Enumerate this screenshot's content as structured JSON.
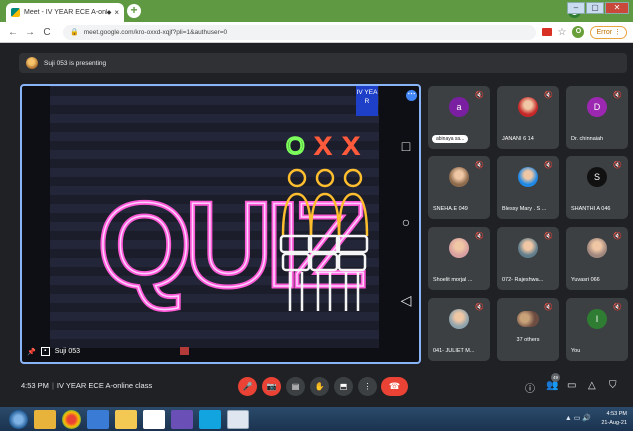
{
  "browser": {
    "tab_title": "Meet - IV YEAR ECE A-onlin",
    "tab_close": "×",
    "new_tab": "+",
    "url": "meet.google.com/kro-oxxd-xqjf?pli=1&authuser=0",
    "error_button": "Error",
    "profile_letter": "O",
    "win_min": "–",
    "win_max": "▢",
    "win_close": "✕"
  },
  "presenting_banner": "Suji 053 is presenting",
  "stage": {
    "slide_year_label": "IV YEA R",
    "quiz_text": "QUIZ",
    "marks": [
      "O",
      "X",
      "X"
    ],
    "presenter_name": "Suji 053",
    "android_buttons": [
      "□",
      "○",
      "◁"
    ]
  },
  "participants": [
    {
      "name": "abinaya sa...",
      "avatar_letter": "a",
      "avatar_color": "#7b1fa2",
      "kind": "letter",
      "style": "pill"
    },
    {
      "name": "JANANI 6 14",
      "avatar_letter": "",
      "avatar_color": "#c62828",
      "kind": "photo"
    },
    {
      "name": "Dr. chinnaiah",
      "avatar_letter": "D",
      "avatar_color": "#9c27b0",
      "kind": "letter"
    },
    {
      "name": "SNEHA.E 049",
      "avatar_letter": "",
      "avatar_color": "#8e6b4d",
      "kind": "photo"
    },
    {
      "name": "Blessy Mary . S ...",
      "avatar_letter": "",
      "avatar_color": "#1e88e5",
      "kind": "photo"
    },
    {
      "name": "SHANTHI A 046",
      "avatar_letter": "S",
      "avatar_color": "#111111",
      "kind": "letter"
    },
    {
      "name": "Shoelit morjal ...",
      "avatar_letter": "",
      "avatar_color": "#d8a0a0",
      "kind": "photo"
    },
    {
      "name": "072- Rajeshwa...",
      "avatar_letter": "",
      "avatar_color": "#607d8b",
      "kind": "photo"
    },
    {
      "name": "Yuvasri 066",
      "avatar_letter": "",
      "avatar_color": "#a1887f",
      "kind": "photo"
    },
    {
      "name": "041- JULIET M...",
      "avatar_letter": "",
      "avatar_color": "#90a4ae",
      "kind": "photo"
    },
    {
      "name": "37 others",
      "avatar_letter": "",
      "avatar_color": "#8d6e63",
      "kind": "others"
    },
    {
      "name": "You",
      "avatar_letter": "I",
      "avatar_color": "#2e7d32",
      "kind": "letter"
    }
  ],
  "bottom": {
    "time": "4:53 PM",
    "separator": "|",
    "meeting_name": "IV YEAR ECE A-online class",
    "participant_count": "49"
  },
  "taskbar": {
    "time": "4:53 PM",
    "date": "21-Aug-21"
  }
}
